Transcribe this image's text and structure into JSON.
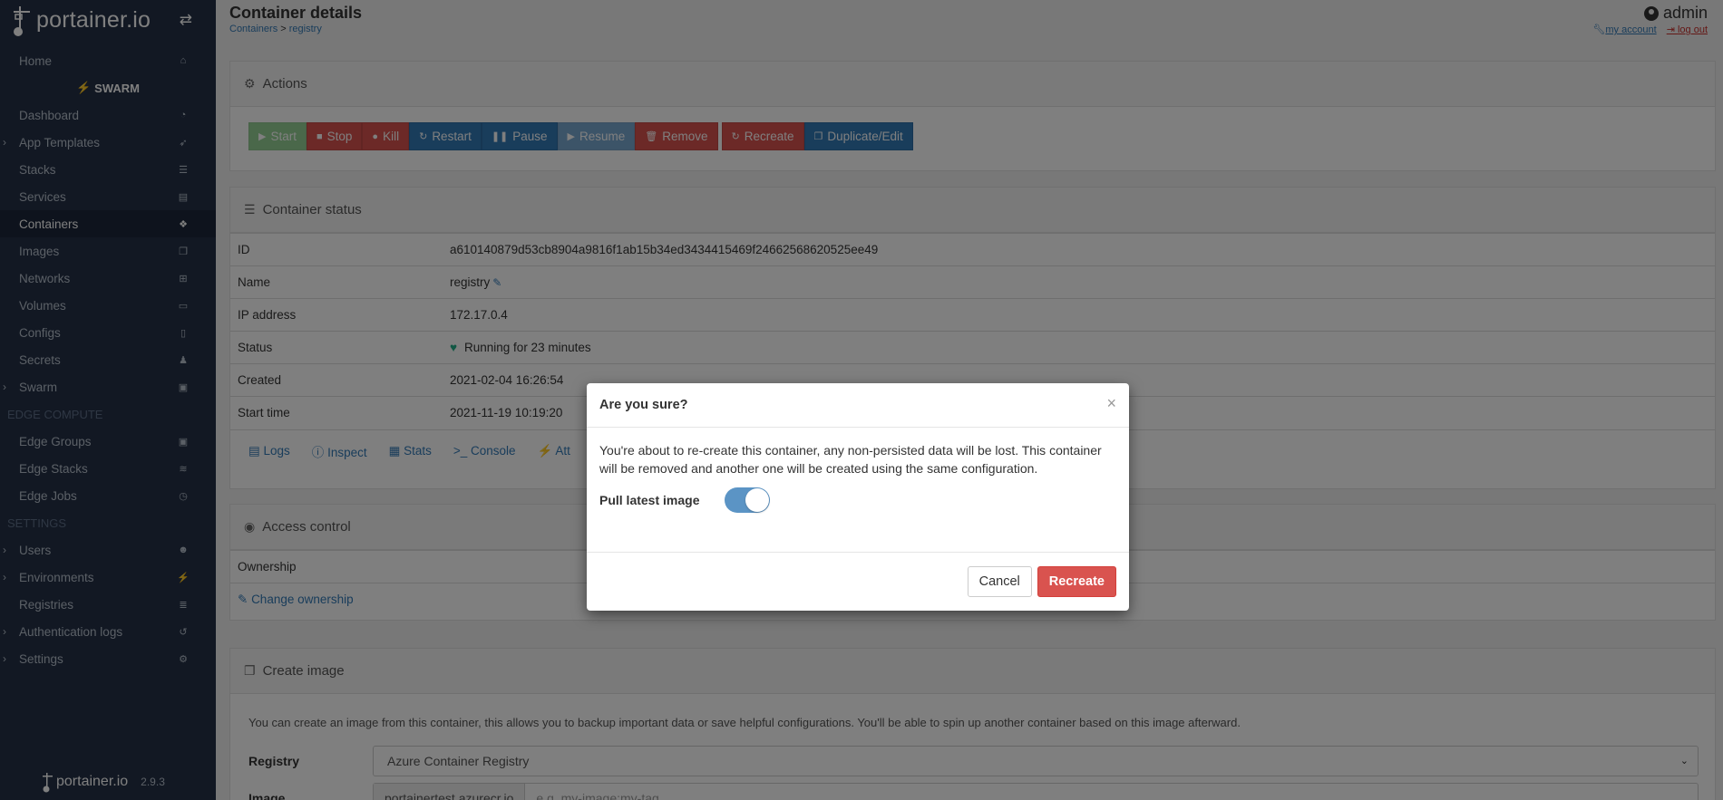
{
  "app": {
    "brand": "portainer.io",
    "version": "2.9.3"
  },
  "sidebar": {
    "home": "Home",
    "swarm_header": "SWARM",
    "items": [
      {
        "label": "Dashboard",
        "icon": "dashboard-icon",
        "caret": false
      },
      {
        "label": "App Templates",
        "icon": "rocket-icon",
        "caret": true
      },
      {
        "label": "Stacks",
        "icon": "list-icon",
        "caret": false
      },
      {
        "label": "Services",
        "icon": "services-icon",
        "caret": false
      },
      {
        "label": "Containers",
        "icon": "cubes-icon",
        "caret": false,
        "active": true
      },
      {
        "label": "Images",
        "icon": "clone-icon",
        "caret": false
      },
      {
        "label": "Networks",
        "icon": "sitemap-icon",
        "caret": false
      },
      {
        "label": "Volumes",
        "icon": "hdd-icon",
        "caret": false
      },
      {
        "label": "Configs",
        "icon": "file-code-icon",
        "caret": false
      },
      {
        "label": "Secrets",
        "icon": "user-secret-icon",
        "caret": false
      },
      {
        "label": "Swarm",
        "icon": "object-group-icon",
        "caret": true
      }
    ],
    "edge_section": "EDGE COMPUTE",
    "edge_items": [
      {
        "label": "Edge Groups",
        "icon": "object-group-icon"
      },
      {
        "label": "Edge Stacks",
        "icon": "layer-group-icon"
      },
      {
        "label": "Edge Jobs",
        "icon": "clock-icon"
      }
    ],
    "settings_section": "SETTINGS",
    "settings_items": [
      {
        "label": "Users",
        "icon": "users-icon",
        "caret": true
      },
      {
        "label": "Environments",
        "icon": "plug-icon",
        "caret": true
      },
      {
        "label": "Registries",
        "icon": "database-icon",
        "caret": false
      },
      {
        "label": "Authentication logs",
        "icon": "history-icon",
        "caret": true
      },
      {
        "label": "Settings",
        "icon": "cogs-icon",
        "caret": true
      }
    ]
  },
  "header": {
    "title": "Container details",
    "breadcrumb_parent": "Containers",
    "breadcrumb_sep": ">",
    "breadcrumb_current": "registry",
    "user": "admin",
    "my_account": "my account",
    "log_out": "log out"
  },
  "actions": {
    "title": "Actions",
    "buttons": {
      "start": "Start",
      "stop": "Stop",
      "kill": "Kill",
      "restart": "Restart",
      "pause": "Pause",
      "resume": "Resume",
      "remove": "Remove",
      "recreate": "Recreate",
      "duplicate": "Duplicate/Edit"
    }
  },
  "status": {
    "title": "Container status",
    "rows": {
      "id_label": "ID",
      "id_value": "a610140879d53cb8904a9816f1ab15b34ed3434415469f24662568620525ee49",
      "name_label": "Name",
      "name_value": "registry",
      "ip_label": "IP address",
      "ip_value": "172.17.0.4",
      "status_label": "Status",
      "status_value": "Running for 23 minutes",
      "created_label": "Created",
      "created_value": "2021-02-04 16:26:54",
      "start_label": "Start time",
      "start_value": "2021-11-19 10:19:20"
    },
    "links": {
      "logs": "Logs",
      "inspect": "Inspect",
      "stats": "Stats",
      "console": "Console",
      "attach": "Att"
    }
  },
  "access": {
    "title": "Access control",
    "ownership_label": "Ownership",
    "change_ownership": "Change ownership"
  },
  "create_image": {
    "title": "Create image",
    "description": "You can create an image from this container, this allows you to backup important data or save helpful configurations. You'll be able to spin up another container based on this image afterward.",
    "registry_label": "Registry",
    "registry_value": "Azure Container Registry",
    "image_label": "Image",
    "image_prefix": "portainertest.azurecr.io",
    "image_placeholder": "e.g. my-image:my-tag"
  },
  "modal": {
    "title": "Are you sure?",
    "close": "×",
    "body": "You're about to re-create this container, any non-persisted data will be lost. This container will be removed and another one will be created using the same configuration.",
    "toggle_label": "Pull latest image",
    "toggle_on": true,
    "cancel": "Cancel",
    "confirm": "Recreate"
  }
}
